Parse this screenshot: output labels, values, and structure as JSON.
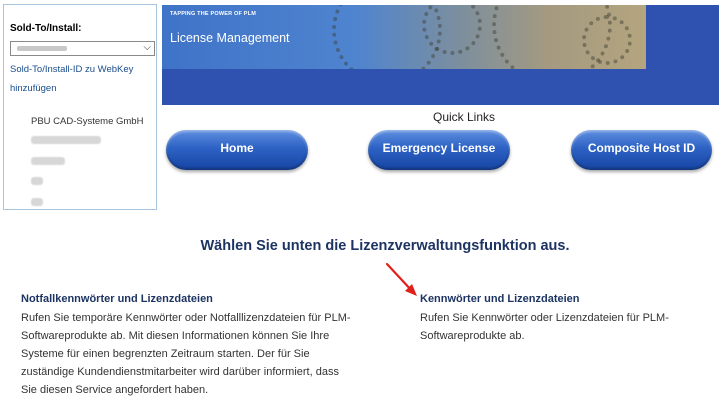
{
  "sidebar": {
    "sold_to_label": "Sold-To/Install:",
    "add_link": "Sold-To/Install-ID zu WebKey hinzufügen",
    "company": "PBU CAD-Systeme GmbH"
  },
  "banner": {
    "tagline": "TAPPING THE POWER OF PLM",
    "title": "License Management"
  },
  "quick_links": {
    "title": "Quick Links",
    "home": "Home",
    "emergency": "Emergency License",
    "composite": "Composite Host ID"
  },
  "main": {
    "headline": "Wählen Sie unten die Lizenzverwaltungsfunktion aus.",
    "left_title": "Notfallkennwörter und Lizenzdateien",
    "left_body": "Rufen Sie temporäre Kennwörter oder Notfalllizenzdateien für PLM-Softwareprodukte ab. Mit diesen Informationen können Sie Ihre Systeme für einen begrenzten Zeitraum starten. Der für Sie zuständige Kundendienstmitarbeiter wird darüber informiert, dass Sie diesen Service angefordert haben.",
    "right_title": "Kennwörter und Lizenzdateien",
    "right_body": "Rufen Sie Kennwörter oder Lizenzdateien für PLM-Softwareprodukte ab."
  },
  "icons": {
    "dropdown": "chevron-down-icon",
    "annotation": "red-arrow-icon"
  },
  "colors": {
    "banner": "#2f51b0",
    "button": "#2d62c4",
    "headline": "#1d3463",
    "arrow": "#e0201a"
  }
}
